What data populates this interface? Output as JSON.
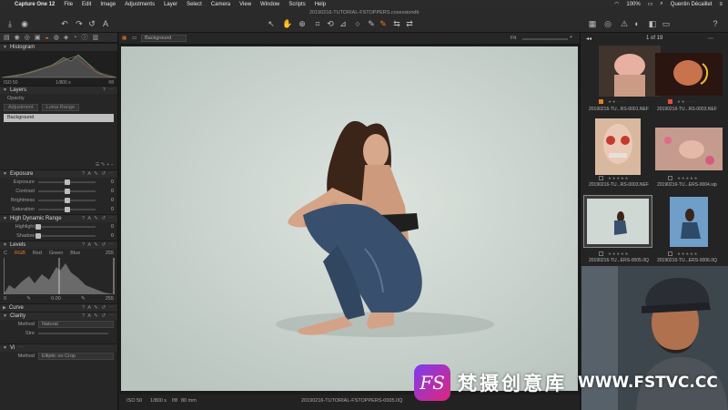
{
  "menubar": {
    "apple": "",
    "app_name": "Capture One 12",
    "items": [
      "File",
      "Edit",
      "Image",
      "Adjustments",
      "Layer",
      "Select",
      "Camera",
      "View",
      "Window",
      "Scripts",
      "Help"
    ],
    "battery": "100%",
    "user": "Quentin Décaillet"
  },
  "toolbar": {
    "document_title": "20190216-TUTORIAL-FSTOPPERS.cosessiondb"
  },
  "layers": {
    "title": "Layers",
    "opacity_label": "Opacity",
    "adjustment_label": "Adjustment",
    "luma_range_label": "Luma Range",
    "background_layer": "Background"
  },
  "histogram": {
    "title": "Histogram",
    "iso": "ISO 50",
    "shutter": "1/800 s",
    "aperture": "f/8"
  },
  "exposure": {
    "title": "Exposure",
    "sliders": [
      {
        "label": "Exposure",
        "value": "0",
        "pos": 0.5
      },
      {
        "label": "Contrast",
        "value": "0",
        "pos": 0.5
      },
      {
        "label": "Brightness",
        "value": "0",
        "pos": 0.5
      },
      {
        "label": "Saturation",
        "value": "0",
        "pos": 0.5
      }
    ]
  },
  "hdr": {
    "title": "High Dynamic Range",
    "sliders": [
      {
        "label": "Highlight",
        "value": "0",
        "pos": 0.0
      },
      {
        "label": "Shadow",
        "value": "0",
        "pos": 0.0
      }
    ]
  },
  "levels": {
    "title": "Levels",
    "channels": [
      "RGB",
      "Red",
      "Green",
      "Blue"
    ],
    "active_channel": "RGB",
    "in_black": "0",
    "in_white": "255",
    "out_black": "0",
    "out_mid": "0.00",
    "out_white": "255",
    "c_label": "C"
  },
  "curve": {
    "title": "Curve"
  },
  "clarity": {
    "title": "Clarity",
    "method_label": "Method",
    "method_value": "Natural",
    "slider_label": "Stre"
  },
  "vignette": {
    "title": "Vi",
    "method_label": "Method",
    "method_value": "Elliptic on Crop"
  },
  "viewer": {
    "layer_select": "Background",
    "fit_label": "Fit"
  },
  "status": {
    "iso": "ISO 50",
    "shutter": "1/800 s",
    "aperture": "f/8",
    "focal": "80 mm",
    "filename": "20190216-TUTORIAL-FSTOPPERS-0005.IIQ"
  },
  "browser": {
    "counter": "1 of 19",
    "thumbnails": [
      {
        "name": "20190216-TU...RS-0001.NEF",
        "color": "#e67e22"
      },
      {
        "name": "20190216-TU...RS-0003.NEF",
        "color": "#e74c3c"
      },
      {
        "name": "20190216-TU...RS-0003.NEF",
        "color": ""
      },
      {
        "name": "20190216-TU...ERS-0004.sip",
        "color": ""
      },
      {
        "name": "20190216-TU...ERS-0005.IIQ",
        "color": ""
      },
      {
        "name": "20190216-TU...ERS-0006.IIQ",
        "color": ""
      }
    ]
  },
  "watermark": {
    "badge": "FS",
    "cn_text": "梵摄创意库",
    "url": "WWW.FSTVC.CC"
  },
  "colors": {
    "accent": "#e67e22",
    "panel_bg": "#262626",
    "backdrop": "#cfd8d3"
  }
}
